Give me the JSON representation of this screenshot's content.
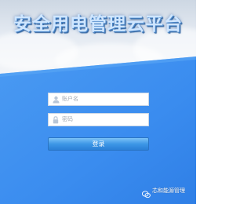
{
  "header": {
    "title": "安全用电管理云平台"
  },
  "login": {
    "username_placeholder": "账户名",
    "password_placeholder": "密码",
    "submit_label": "登录"
  },
  "watermark": {
    "text": "芯和能源管理"
  },
  "colors": {
    "panel_blue": "#3d8ff0",
    "panel_blue_dark": "#2f7fe6",
    "button_blue": "#3d97e6",
    "title_fill": "#cfe6ff"
  },
  "icons": {
    "username": "user-icon",
    "password": "lock-icon",
    "watermark": "wechat-icon"
  }
}
